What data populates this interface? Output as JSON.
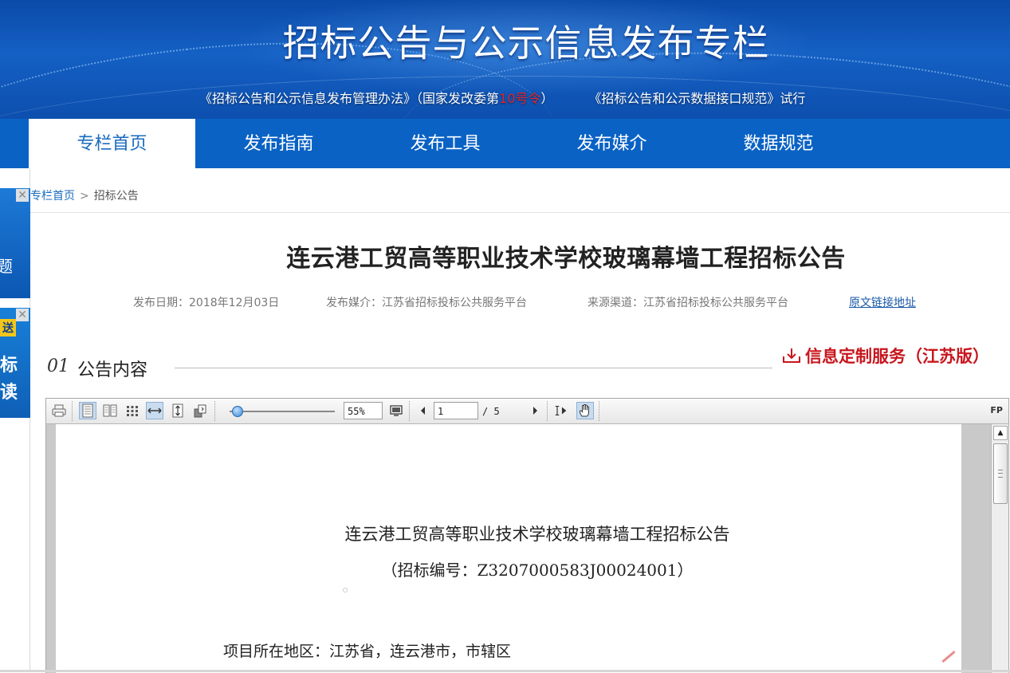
{
  "banner": {
    "title": "招标公告与公示信息发布专栏",
    "sub_part1": "《招标公告和公示信息发布管理办法》（国家发改委第",
    "sub_red": "10号令",
    "sub_part2": "）",
    "sub_part3": "《招标公告和公示数据接口规范》试行"
  },
  "nav": {
    "items": [
      {
        "label": "专栏首页",
        "active": true
      },
      {
        "label": "发布指南"
      },
      {
        "label": "发布工具"
      },
      {
        "label": "发布媒介"
      },
      {
        "label": "数据规范"
      }
    ]
  },
  "ads": {
    "ad1_text": "题",
    "ad2_tag": "送",
    "ad2_line1": "标",
    "ad2_line2": "读",
    "close": "✕"
  },
  "breadcrumb": {
    "home": "专栏首页",
    "sep": ">",
    "current": "招标公告"
  },
  "article": {
    "title": "连云港工贸高等职业技术学校玻璃幕墙工程招标公告",
    "publish_date": "发布日期：2018年12月03日",
    "publish_media": "发布媒介：江苏省招标投标公共服务平台",
    "source": "来源渠道：江苏省招标投标公共服务平台",
    "original_link": "原文链接地址"
  },
  "section": {
    "number": "01",
    "title": "公告内容",
    "custom_service": "信息定制服务（江苏版）"
  },
  "viewer": {
    "zoom": "55%",
    "page_current": "1",
    "page_total": "/ 5",
    "fp_label": "FP",
    "doc_title": "连云港工贸高等职业技术学校玻璃幕墙工程招标公告",
    "doc_number": "（招标编号：Z3207000583J00024001）",
    "doc_line1": "项目所在地区：江苏省，连云港市，市辖区",
    "zoom_level": 0.55
  },
  "colors": {
    "nav_bg": "#0a62c4",
    "link": "#1a6bbf",
    "accent_red": "#c8161d"
  }
}
